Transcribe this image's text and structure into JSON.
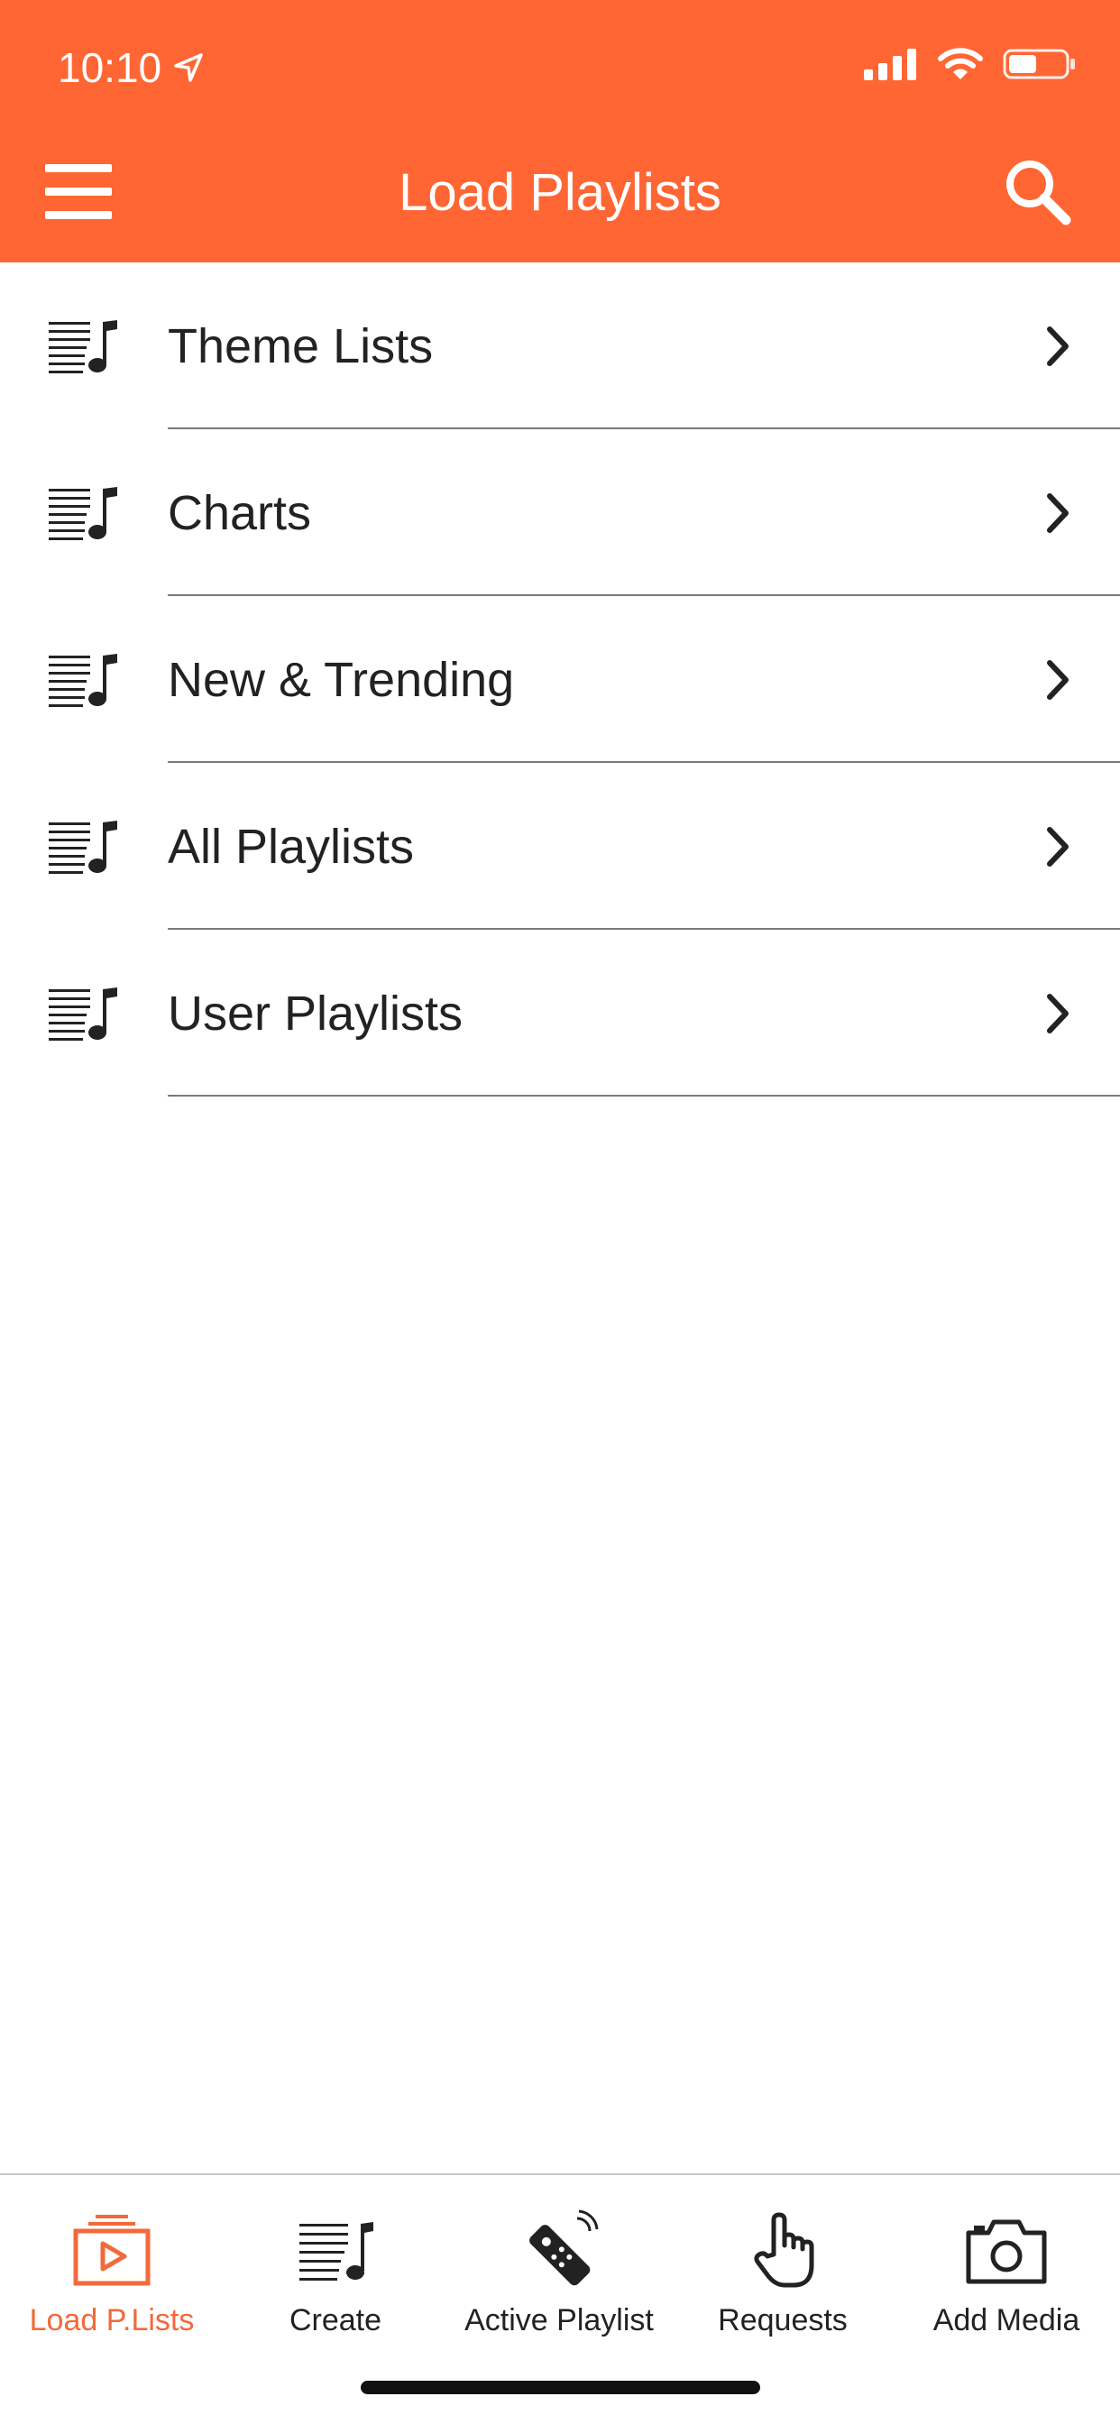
{
  "status_bar": {
    "time": "10:10"
  },
  "colors": {
    "accent": "#FF6633",
    "active_tab": "#F26A3B",
    "text": "#222222",
    "divider": "#7a7a7a"
  },
  "nav": {
    "title": "Load Playlists",
    "left_icon": "hamburger-menu-icon",
    "right_icon": "search-icon"
  },
  "list": {
    "items": [
      {
        "label": "Theme Lists",
        "icon": "playlist-music-icon"
      },
      {
        "label": "Charts",
        "icon": "playlist-music-icon"
      },
      {
        "label": "New & Trending",
        "icon": "playlist-music-icon"
      },
      {
        "label": "All Playlists",
        "icon": "playlist-music-icon"
      },
      {
        "label": "User Playlists",
        "icon": "playlist-music-icon"
      }
    ]
  },
  "tabbar": {
    "active_index": 0,
    "tabs": [
      {
        "label": "Load P.Lists",
        "icon": "load-playlists-icon"
      },
      {
        "label": "Create",
        "icon": "create-playlist-icon"
      },
      {
        "label": "Active Playlist",
        "icon": "remote-control-icon"
      },
      {
        "label": "Requests",
        "icon": "hand-pointer-icon"
      },
      {
        "label": "Add Media",
        "icon": "camera-icon"
      }
    ]
  }
}
